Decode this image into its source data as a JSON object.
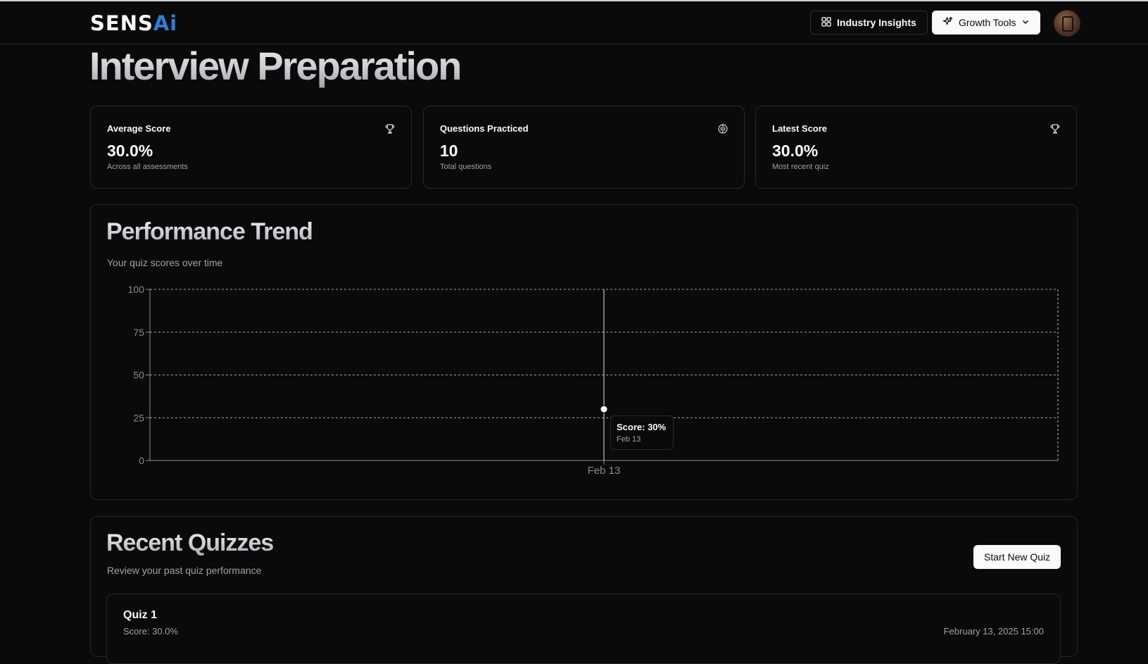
{
  "header": {
    "logo_main": "SENS",
    "logo_accent": "Ai",
    "industry_insights_label": "Industry Insights",
    "growth_tools_label": "Growth Tools"
  },
  "page": {
    "title": "Interview Preparation"
  },
  "stats": [
    {
      "label": "Average Score",
      "value": "30.0%",
      "sub": "Across all assessments",
      "icon": "trophy-icon"
    },
    {
      "label": "Questions Practiced",
      "value": "10",
      "sub": "Total questions",
      "icon": "brain-icon"
    },
    {
      "label": "Latest Score",
      "value": "30.0%",
      "sub": "Most recent quiz",
      "icon": "trophy-icon"
    }
  ],
  "performance": {
    "title": "Performance Trend",
    "subtitle": "Your quiz scores over time",
    "tooltip": {
      "score": "Score: 30%",
      "date": "Feb 13"
    }
  },
  "chart_data": {
    "type": "line",
    "x": [
      "Feb 13"
    ],
    "series": [
      {
        "values": [
          30
        ]
      }
    ],
    "xlabel": "",
    "ylabel": "",
    "ylim": [
      0,
      100
    ],
    "yticks": [
      0,
      25,
      50,
      75,
      100
    ],
    "grid": true,
    "tooltip_visible": true
  },
  "recent": {
    "title": "Recent Quizzes",
    "subtitle": "Review your past quiz performance",
    "start_button": "Start New Quiz",
    "quizzes": [
      {
        "title": "Quiz 1",
        "score": "Score: 30.0%",
        "date": "February 13, 2025 15:00"
      }
    ]
  },
  "colors": {
    "background": "#0a0a0a",
    "border": "#262626",
    "muted_text": "#a1a1a1",
    "logo_accent": "#2b7fd8"
  }
}
